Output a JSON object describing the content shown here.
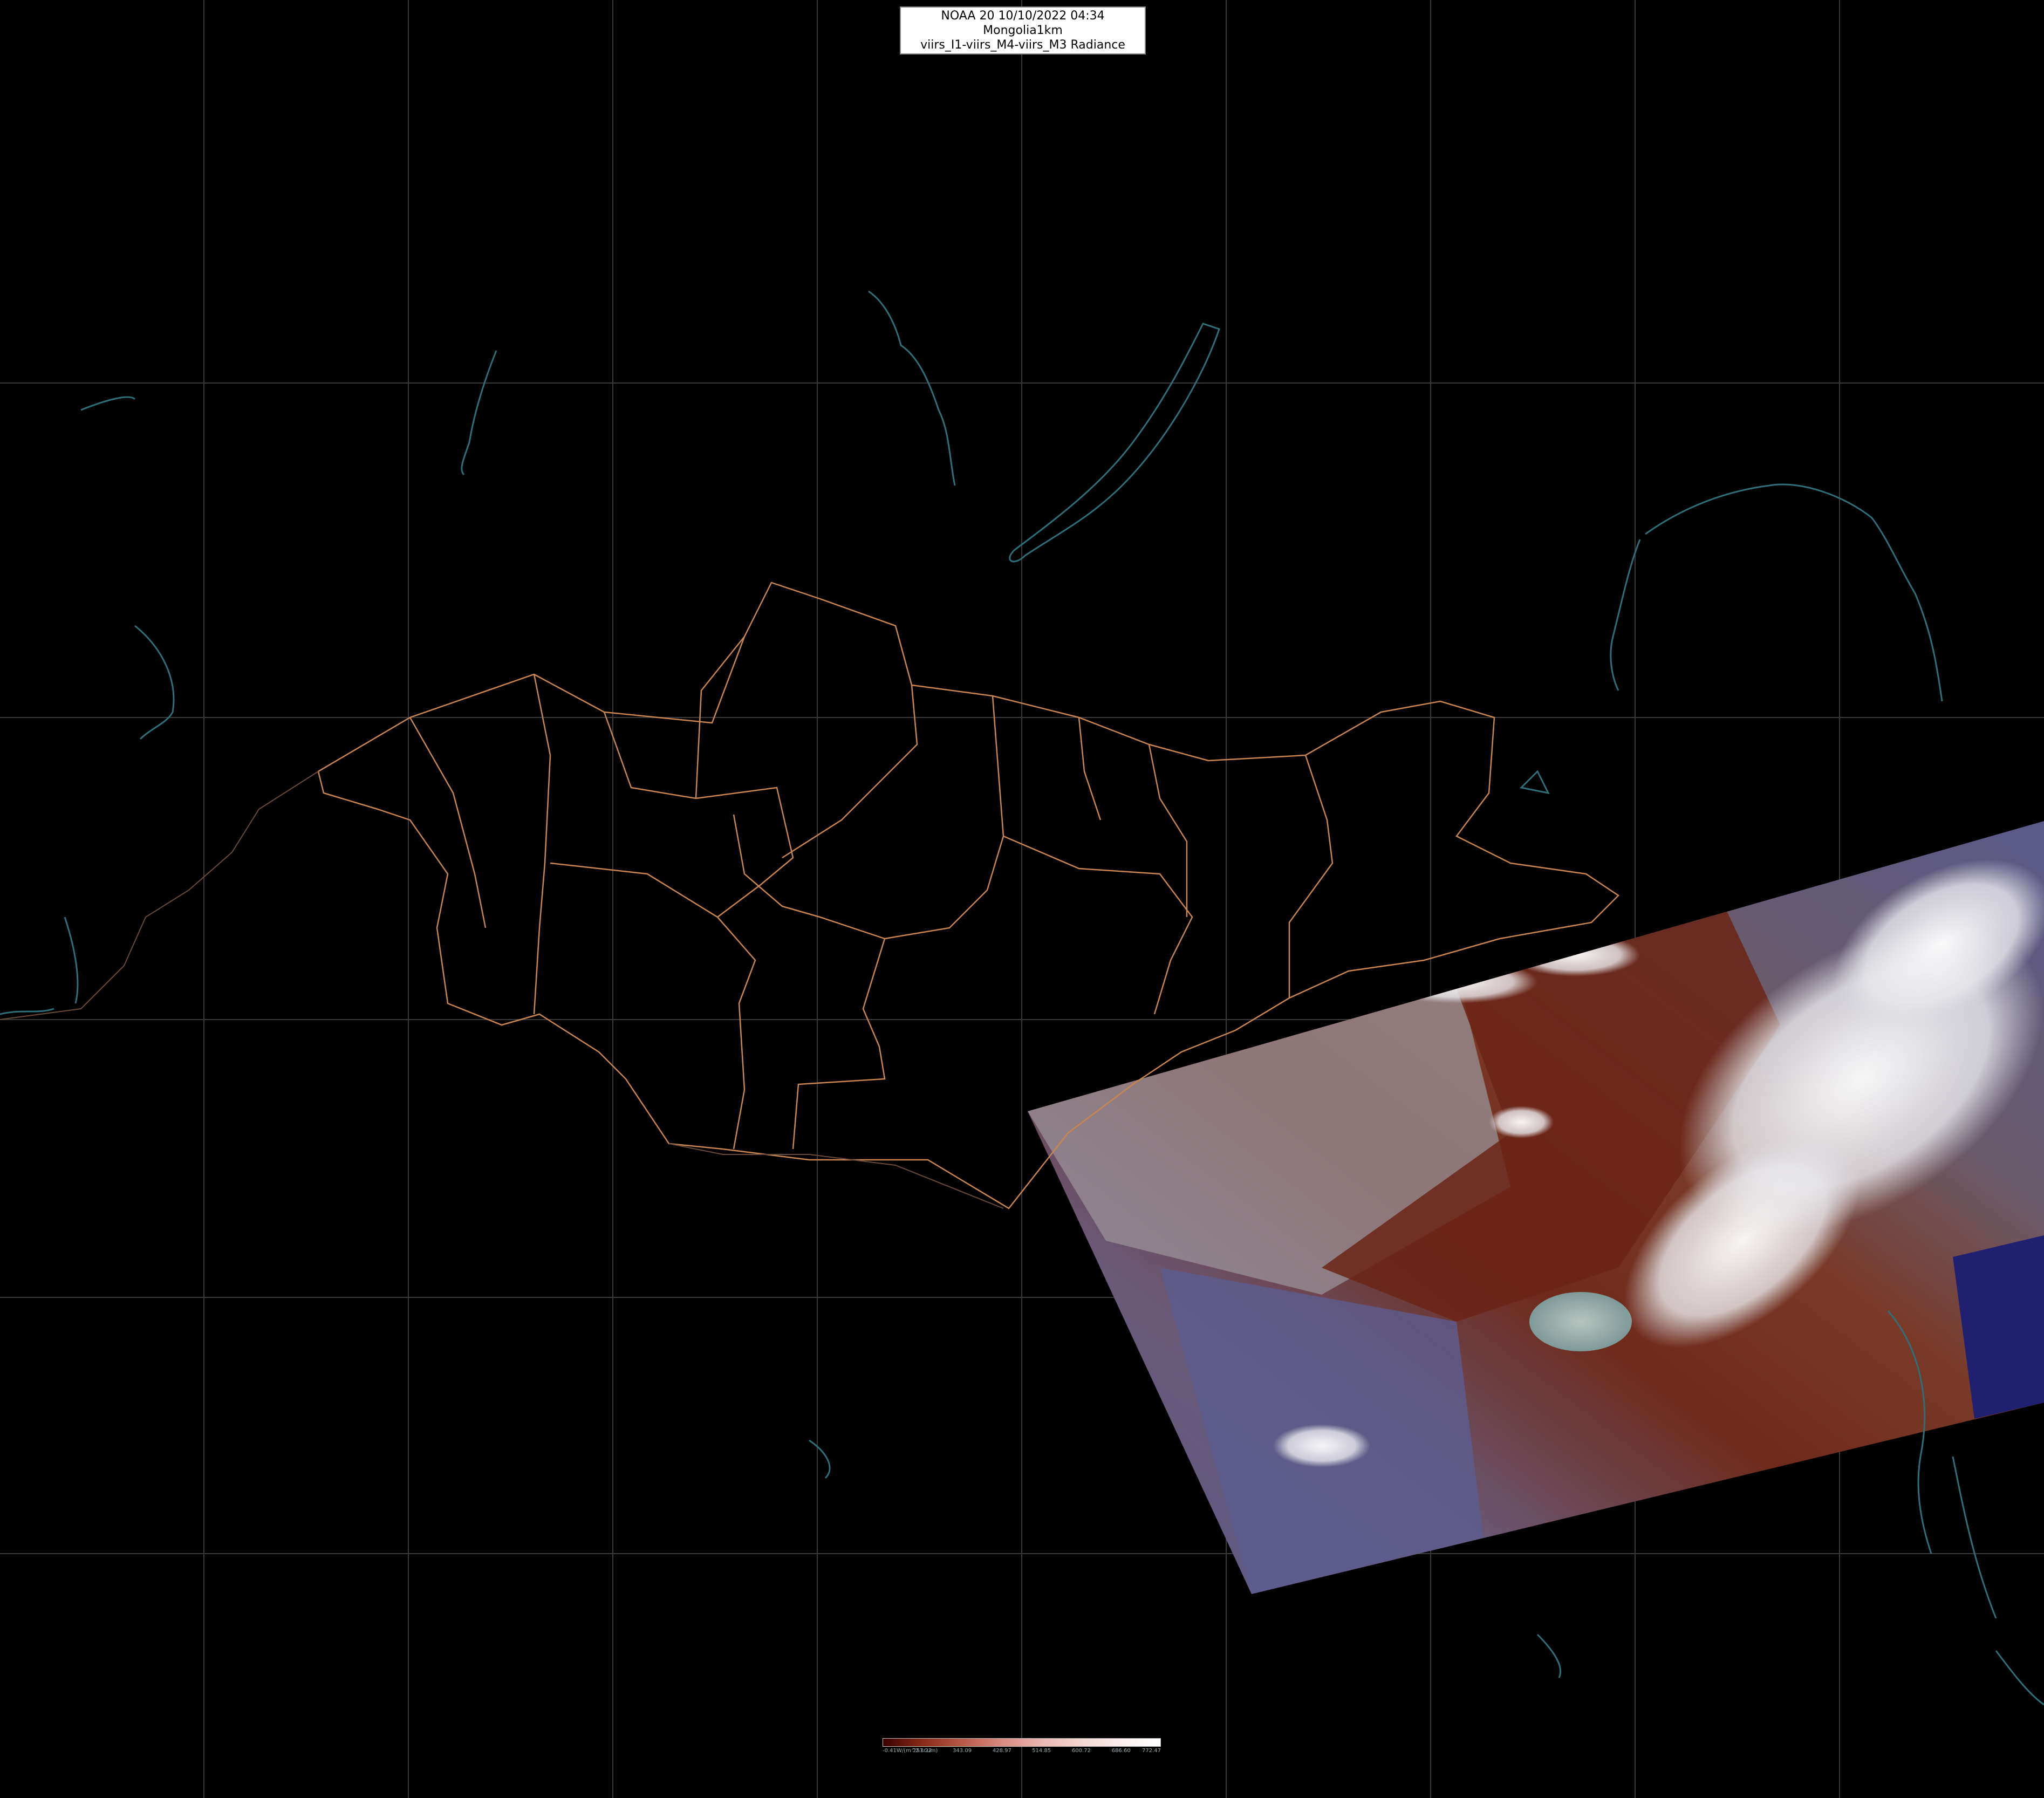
{
  "title": {
    "line1": "NOAA 20 10/10/2022 04:34 Mongolia1km",
    "line2": "viirs_I1-viirs_M4-viirs_M3 Radiance"
  },
  "colorbar": {
    "labels": [
      "-0.41W/(m^2.sr.um)",
      "257.22",
      "343.09",
      "428.97",
      "514.85",
      "600.72",
      "686.60",
      "772.47"
    ],
    "colors": [
      "#3a0000",
      "#8a2a18",
      "#b85a48",
      "#d98a80",
      "#e9b7b0",
      "#f3d7d2",
      "#fbeeee",
      "#ffffff"
    ]
  },
  "colors": {
    "background": "#000000",
    "graticule": "#3a3a3a",
    "admin_border": "#c98550",
    "coastline": "#2f6f78"
  }
}
